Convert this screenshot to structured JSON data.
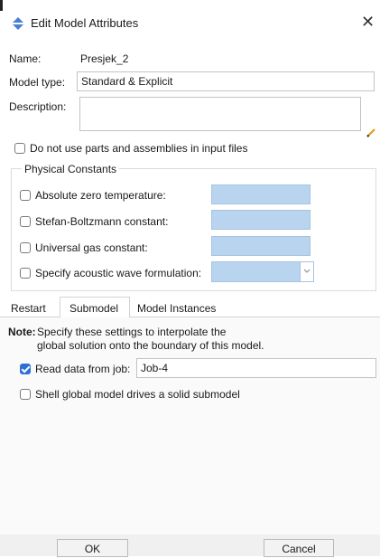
{
  "window": {
    "title": "Edit Model Attributes",
    "close": "✕"
  },
  "name": {
    "label": "Name:",
    "value": "Presjek_2"
  },
  "model_type": {
    "label": "Model type:",
    "value": "Standard & Explicit"
  },
  "description": {
    "label": "Description:",
    "value": ""
  },
  "no_parts": {
    "label": "Do not use parts and assemblies in input files",
    "checked": false
  },
  "physical_constants": {
    "title": "Physical Constants",
    "items": [
      {
        "label": "Absolute zero temperature:",
        "value": ""
      },
      {
        "label": "Stefan-Boltzmann constant:",
        "value": ""
      },
      {
        "label": "Universal gas constant:",
        "value": ""
      },
      {
        "label": "Specify acoustic wave formulation:",
        "value": ""
      }
    ]
  },
  "tabs": {
    "restart": "Restart",
    "submodel": "Submodel",
    "model_instances": "Model Instances",
    "active": "Submodel"
  },
  "note": {
    "label": "Note:",
    "line1": "Specify these settings to interpolate the",
    "line2": "global solution onto the boundary of this model."
  },
  "read_data": {
    "label": "Read data from job:",
    "value": "Job-4",
    "checked": true
  },
  "shell_global": {
    "label": "Shell global model drives a solid submodel",
    "checked": false
  },
  "buttons": {
    "ok": "OK",
    "cancel": "Cancel"
  },
  "colors": {
    "accent": "#2b6fd6",
    "disabled_field": "#b8d4ee"
  }
}
